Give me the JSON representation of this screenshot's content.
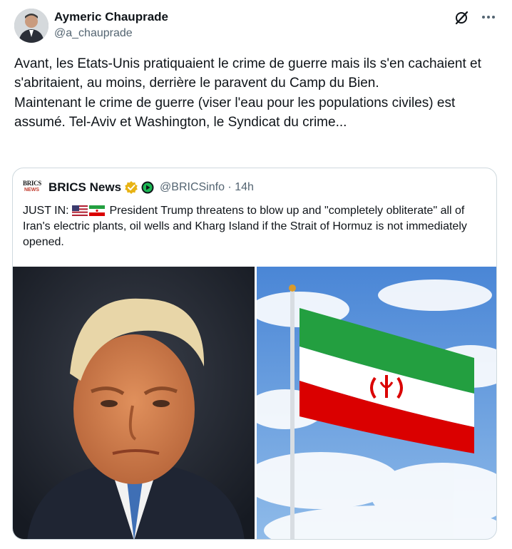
{
  "author": {
    "name": "Aymeric Chauprade",
    "handle": "@a_chauprade",
    "icons": [
      "avatar",
      "grok-icon",
      "more-icon"
    ]
  },
  "tweet": {
    "text": "Avant, les Etats-Unis pratiquaient le crime de guerre mais ils s'en cachaient et s'abritaient, au moins, derrière le paravent du Camp du Bien.\nMaintenant le crime de guerre (viser l'eau pour les populations civiles) est assumé. Tel-Aviv et Washington, le Syndicat du crime..."
  },
  "quote": {
    "logo_line1": "BRICS",
    "logo_line2": "NEWS",
    "name": "BRICS News",
    "handle_time": "@BRICSinfo · 14h",
    "text_prefix": "JUST IN:",
    "text_body": " President Trump threatens to blow up and \"completely obliterate\" all of Iran's electric plants, oil wells and Kharg Island if the Strait of Hormuz is not immediately opened.",
    "flags": [
      "us-flag",
      "iran-flag"
    ],
    "images": [
      "portrait-photo",
      "iran-flag-photo"
    ]
  },
  "colors": {
    "text": "#0f1419",
    "secondary": "#536471",
    "border": "#cfd9de",
    "verified": "#e8b314",
    "iran_green": "#239f40",
    "iran_red": "#da0000"
  }
}
